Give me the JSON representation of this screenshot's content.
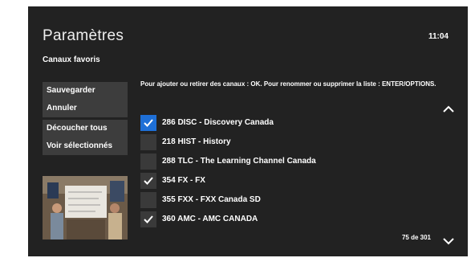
{
  "header": {
    "title": "Paramètres",
    "time": "11:04",
    "subtitle": "Canaux favoris"
  },
  "menu": {
    "group1": [
      "Sauvegarder",
      "Annuler"
    ],
    "group2": [
      "Découcher tous",
      "Voir sélectionnés"
    ]
  },
  "instructions": "Pour ajouter ou retirer des canaux : OK. Pour renommer ou supprimer la liste : ENTER/OPTIONS.",
  "channels": [
    {
      "label": "286 DISC - Discovery Canada",
      "checked": true,
      "focused": true
    },
    {
      "label": "218 HIST - History",
      "checked": false,
      "focused": false
    },
    {
      "label": "288 TLC - The Learning Channel Canada",
      "checked": false,
      "focused": false
    },
    {
      "label": "354 FX - FX",
      "checked": true,
      "focused": false
    },
    {
      "label": "355 FXX - FXX Canada SD",
      "checked": false,
      "focused": false
    },
    {
      "label": "360 AMC - AMC CANADA",
      "checked": true,
      "focused": false
    }
  ],
  "pager": "75 de 301",
  "icons": {
    "scroll_up": "chevron-up-icon",
    "scroll_down": "chevron-down-icon",
    "check": "checkmark-icon"
  },
  "colors": {
    "background": "#222222",
    "menu_bg": "#3d3d3d",
    "focus": "#1e6fd6",
    "checkbox_bg": "#3a3a3a"
  }
}
